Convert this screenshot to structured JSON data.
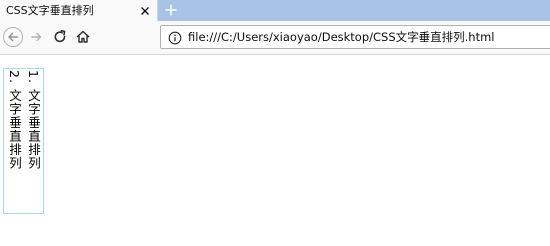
{
  "browser": {
    "tab": {
      "title": "CSS文字垂直排列"
    },
    "address": {
      "url": "file:///C:/Users/xiaoyao/Desktop/CSS文字垂直排列.html"
    }
  },
  "page": {
    "lines": [
      "1. 文字垂直排列",
      "2. 文字垂直排列"
    ]
  },
  "colors": {
    "tabstrip": "#a9c3e6",
    "toolbar": "#f9f9fa",
    "box_border": "#a8dbe8"
  }
}
